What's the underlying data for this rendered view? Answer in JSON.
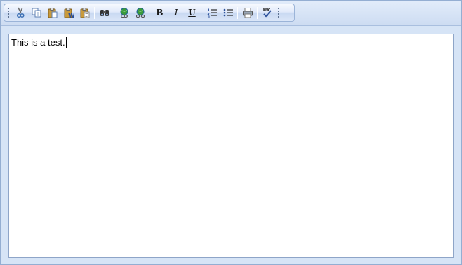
{
  "toolbar": {
    "buttons": [
      {
        "name": "cut",
        "icon": "scissors-icon"
      },
      {
        "name": "copy",
        "icon": "copy-icon"
      },
      {
        "name": "paste",
        "icon": "paste-icon"
      },
      {
        "name": "paste-from-word",
        "icon": "paste-word-icon"
      },
      {
        "name": "paste-plain",
        "icon": "paste-plain-icon"
      },
      {
        "name": "find",
        "icon": "binoculars-icon"
      },
      {
        "name": "insert-link",
        "icon": "globe-link-icon"
      },
      {
        "name": "remove-link",
        "icon": "globe-unlink-icon"
      },
      {
        "name": "bold",
        "label": "B"
      },
      {
        "name": "italic",
        "label": "I"
      },
      {
        "name": "underline",
        "label": "U"
      },
      {
        "name": "numbered-list",
        "icon": "ordered-list-icon"
      },
      {
        "name": "bulleted-list",
        "icon": "bullet-list-icon"
      },
      {
        "name": "print",
        "icon": "printer-icon"
      },
      {
        "name": "spell-check",
        "icon": "spellcheck-icon",
        "label": "ABC"
      }
    ]
  },
  "editor": {
    "content": "This is a test."
  },
  "colors": {
    "frame": "#d6e4f6",
    "toolbar_border": "#9bb4d8",
    "content_border": "#8ea5c8",
    "icon_blue": "#3c6fb4",
    "icon_green": "#3a9a3a"
  }
}
